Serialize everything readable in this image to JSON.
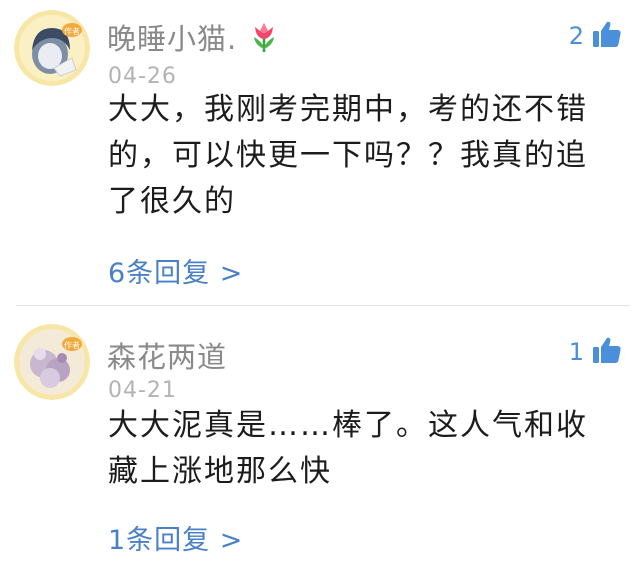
{
  "comments": [
    {
      "username": "晚睡小猫.",
      "badge_icon": "tulip-icon",
      "badge_text": "作者",
      "likes": "2",
      "date": "04-26",
      "text": "大大，我刚考完期中，考的还不错的，可以快更一下吗？？我真的追了很久的",
      "replies": "6条回复 >"
    },
    {
      "username": "森花两道",
      "badge_text": "作者",
      "likes": "1",
      "date": "04-21",
      "text": "大大泥真是……棒了。这人气和收藏上涨地那么快",
      "replies": "1条回复 >"
    }
  ],
  "colors": {
    "link": "#4a80c8",
    "like": "#4a8fd9",
    "username": "#8a8a8a",
    "date": "#b3b3b3",
    "text": "#1c1c1c"
  }
}
